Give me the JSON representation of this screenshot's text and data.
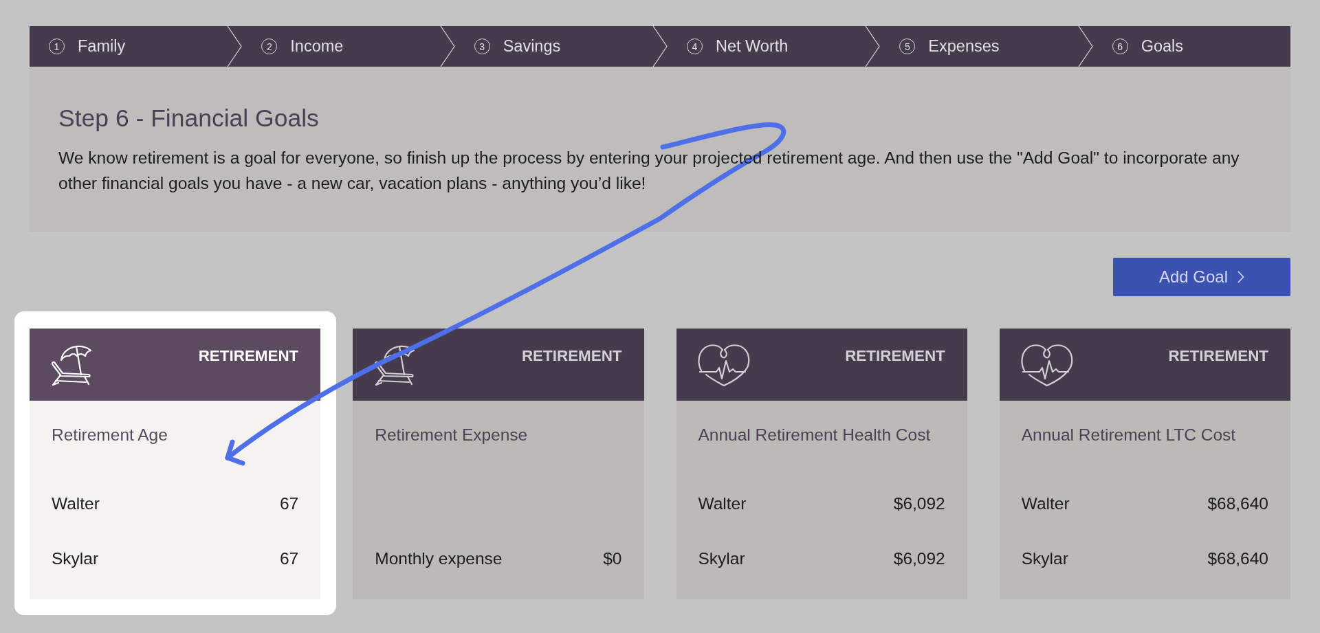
{
  "steps": [
    {
      "number": "1",
      "label": "Family"
    },
    {
      "number": "2",
      "label": "Income"
    },
    {
      "number": "3",
      "label": "Savings"
    },
    {
      "number": "4",
      "label": "Net Worth"
    },
    {
      "number": "5",
      "label": "Expenses"
    },
    {
      "number": "6",
      "label": "Goals"
    }
  ],
  "intro": {
    "title": "Step 6 - Financial Goals",
    "text": "We know retirement is a goal for everyone, so finish up the process by entering your projected retirement age. And then use the \"Add Goal\" to incorporate any other financial goals you have - a new car, vacation plans - anything you’d like!"
  },
  "add_goal_button": {
    "label": "Add Goal"
  },
  "goal_cards": [
    {
      "kind": "leisure",
      "category": "RETIREMENT",
      "title": "Retirement Age",
      "highlighted": true,
      "rows": [
        {
          "label": "Walter",
          "value": "67"
        },
        {
          "label": "Skylar",
          "value": "67"
        }
      ]
    },
    {
      "kind": "leisure",
      "category": "RETIREMENT",
      "title": "Retirement Expense",
      "highlighted": false,
      "rows": [
        {
          "label": "Monthly expense",
          "value": "$0"
        }
      ]
    },
    {
      "kind": "health",
      "category": "RETIREMENT",
      "title": "Annual Retirement Health Cost",
      "highlighted": false,
      "rows": [
        {
          "label": "Walter",
          "value": "$6,092"
        },
        {
          "label": "Skylar",
          "value": "$6,092"
        }
      ]
    },
    {
      "kind": "health",
      "category": "RETIREMENT",
      "title": "Annual Retirement LTC Cost",
      "highlighted": false,
      "rows": [
        {
          "label": "Walter",
          "value": "$68,640"
        },
        {
          "label": "Skylar",
          "value": "$68,640"
        }
      ]
    }
  ],
  "pointer_arrow": true
}
